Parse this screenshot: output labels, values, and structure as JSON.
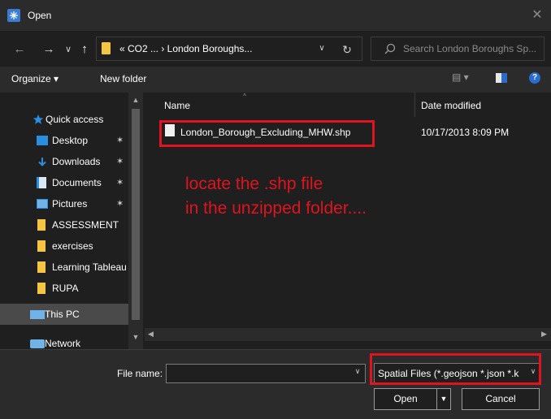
{
  "window": {
    "title": "Open",
    "close_icon": "close-icon",
    "app_icon": "dialog-app-icon"
  },
  "nav": {
    "back_glyph": "←",
    "forward_glyph": "→",
    "recent_glyph": "∨",
    "up_glyph": "↑",
    "address_path": "« CO2 ... › London Boroughs...",
    "address_dropdown_glyph": "∨",
    "refresh_glyph": "↻",
    "search_placeholder": "Search London Boroughs Sp..."
  },
  "toolbar": {
    "organize_label": "Organize ▾",
    "new_folder_label": "New folder",
    "view_glyph": "▤ ▾",
    "help_label": "?"
  },
  "sidebar": {
    "items": [
      {
        "label": "Quick access",
        "icon": "star-icon",
        "pinned": false
      },
      {
        "label": "Desktop",
        "icon": "desktop-icon",
        "pinned": true
      },
      {
        "label": "Downloads",
        "icon": "download-icon",
        "pinned": true
      },
      {
        "label": "Documents",
        "icon": "documents-icon",
        "pinned": true
      },
      {
        "label": "Pictures",
        "icon": "pictures-icon",
        "pinned": true
      },
      {
        "label": "ASSESSMENT",
        "icon": "folder-icon",
        "pinned": false
      },
      {
        "label": "exercises",
        "icon": "folder-icon",
        "pinned": false
      },
      {
        "label": "Learning Tableau",
        "icon": "folder-icon",
        "pinned": false
      },
      {
        "label": "RUPA",
        "icon": "folder-icon",
        "pinned": false
      },
      {
        "label": "This PC",
        "icon": "this-pc-icon",
        "pinned": false
      },
      {
        "label": "Network",
        "icon": "network-icon",
        "pinned": false
      }
    ],
    "pin_glyph": "📌"
  },
  "filelist": {
    "columns": {
      "name": "Name",
      "date": "Date modified"
    },
    "sort_glyph": "^",
    "rows": [
      {
        "name": "London_Borough_Excluding_MHW.shp",
        "date": "10/17/2013 8:09 PM"
      }
    ]
  },
  "annotation": {
    "line1": "locate the .shp file",
    "line2": "in the unzipped folder....",
    "color": "#e0141e"
  },
  "footer": {
    "filename_label": "File name:",
    "filename_value": "",
    "filetype": "Spatial Files (*.geojson *.json *.k",
    "open_label": "Open",
    "cancel_label": "Cancel"
  },
  "colors": {
    "bg": "#1f1f1f",
    "chrome": "#2b2b2b",
    "accent": "#2a6bd1",
    "folder": "#f4c542",
    "highlight": "#e0141e"
  }
}
